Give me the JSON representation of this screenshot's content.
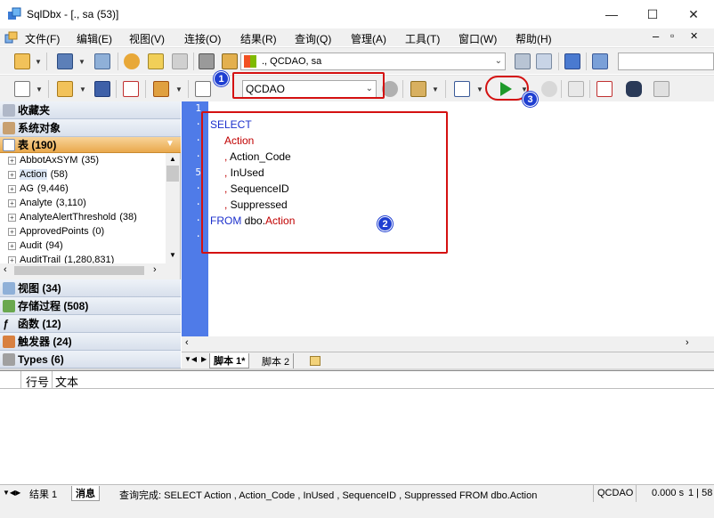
{
  "window": {
    "title": "SqlDbx - [., sa (53)]",
    "minimize_glyph": "—",
    "maximize_glyph": "☐",
    "close_glyph": "✕"
  },
  "menu": {
    "items": [
      "文件(F)",
      "编辑(E)",
      "视图(V)",
      "连接(O)",
      "结果(R)",
      "查询(Q)",
      "管理(A)",
      "工具(T)",
      "窗口(W)",
      "帮助(H)"
    ],
    "mdi_min": "–",
    "mdi_restore": "▫",
    "mdi_close": "✕"
  },
  "toolbar1": {
    "connection_combo": "., QCDAO, sa"
  },
  "toolbar2": {
    "database_combo": "QCDAO"
  },
  "left_panel": {
    "favorites": "收藏夹",
    "system_objects": "系统对象",
    "tables_header": "表  (190)",
    "tables": [
      {
        "name": "AbbotAxSYM",
        "count": "(35)"
      },
      {
        "name": "Action",
        "count": "(58)"
      },
      {
        "name": "AG",
        "count": "(9,446)"
      },
      {
        "name": "Analyte",
        "count": "(3,110)"
      },
      {
        "name": "AnalyteAlertThreshold",
        "count": "(38)"
      },
      {
        "name": "ApprovedPoints",
        "count": "(0)"
      },
      {
        "name": "Audit",
        "count": "(94)"
      },
      {
        "name": "AuditTrail",
        "count": "(1,280,831)"
      }
    ],
    "views": "视图  (34)",
    "procs": "存储过程  (508)",
    "functions": "函数  (12)",
    "triggers": "触发器  (24)",
    "types": "Types  (6)"
  },
  "editor": {
    "line_numbers": [
      "1",
      "·",
      "·",
      "·",
      "5",
      "·",
      "·",
      "·",
      "·"
    ],
    "code": {
      "select": "SELECT",
      "l2": "Action",
      "l3_comma": ", ",
      "l3": "Action_Code",
      "l4_comma": ", ",
      "l4": "InUsed",
      "l5_comma": ", ",
      "l5": "SequenceID",
      "l6_comma": ", ",
      "l6": "Suppressed",
      "from": "FROM",
      "table": "dbo.",
      "table2": "Action"
    }
  },
  "script_tabs": [
    "脚本 1*",
    "脚本 2"
  ],
  "results": {
    "columns": [
      "行号",
      "文本"
    ]
  },
  "bottom_tabs": [
    "结果 1",
    "消息"
  ],
  "status": {
    "message": "查询完成: SELECT  Action  , Action_Code  , InUsed  , SequenceID  , Suppressed  FROM dbo.Action",
    "database": "QCDAO",
    "time": "0.000 s",
    "position": "1 | 58"
  },
  "annotations": [
    "1",
    "2",
    "3"
  ],
  "colors": {
    "highlight_red": "#d41111",
    "badge_blue": "#1f3fd1",
    "gutter_blue": "#4f7be8",
    "keyword_blue": "#1b2fcc",
    "column_red": "#c00000"
  }
}
